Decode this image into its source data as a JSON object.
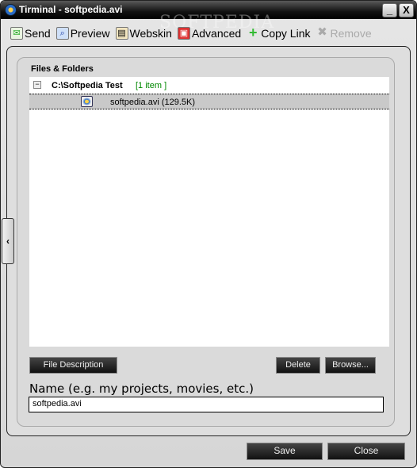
{
  "window": {
    "title": "Tirminal - softpedia.avi",
    "minimize": "_",
    "close": "X",
    "watermark": "SOFTPEDIA"
  },
  "toolbar": [
    {
      "label": "Send",
      "icon": "send-icon",
      "enabled": true
    },
    {
      "label": "Preview",
      "icon": "preview-icon",
      "enabled": true
    },
    {
      "label": "Webskin",
      "icon": "webskin-icon",
      "enabled": true
    },
    {
      "label": "Advanced",
      "icon": "advanced-icon",
      "enabled": true
    },
    {
      "label": "Copy Link",
      "icon": "plus-icon",
      "enabled": true
    },
    {
      "label": "Remove",
      "icon": "remove-icon",
      "enabled": false
    }
  ],
  "files": {
    "label": "Files & Folders",
    "root": "C:\\Softpedia Test",
    "root_count": "[1 item ]",
    "items": [
      {
        "name": "softpedia.avi (129.5K)"
      }
    ]
  },
  "buttons": {
    "file_description": "File Description",
    "delete": "Delete",
    "browse": "Browse...",
    "save": "Save",
    "close": "Close"
  },
  "name": {
    "label": "Name (e.g. my projects, movies, etc.)",
    "value": "softpedia.avi"
  },
  "side_toggle": "‹"
}
